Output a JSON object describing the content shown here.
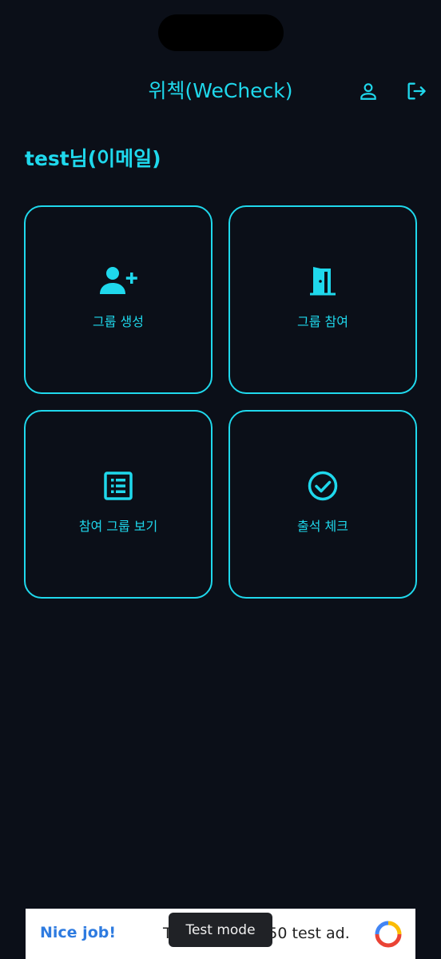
{
  "header": {
    "title": "위첵(WeCheck)",
    "profile_icon": "person-outline-icon",
    "logout_icon": "logout-icon"
  },
  "greeting": "test님(이메일)",
  "menu": [
    {
      "label": "그룹 생성",
      "icon": "person-add-icon"
    },
    {
      "label": "그룹 참여",
      "icon": "door-open-icon"
    },
    {
      "label": "참여 그룹 보기",
      "icon": "list-icon"
    },
    {
      "label": "출석 체크",
      "icon": "check-circle-icon"
    }
  ],
  "ad": {
    "left_text": "Nice job!",
    "middle_text": "This is a 320x50 test ad.",
    "badge": "Test mode"
  },
  "colors": {
    "accent": "#1fd8ec",
    "background": "#0b0f18"
  }
}
